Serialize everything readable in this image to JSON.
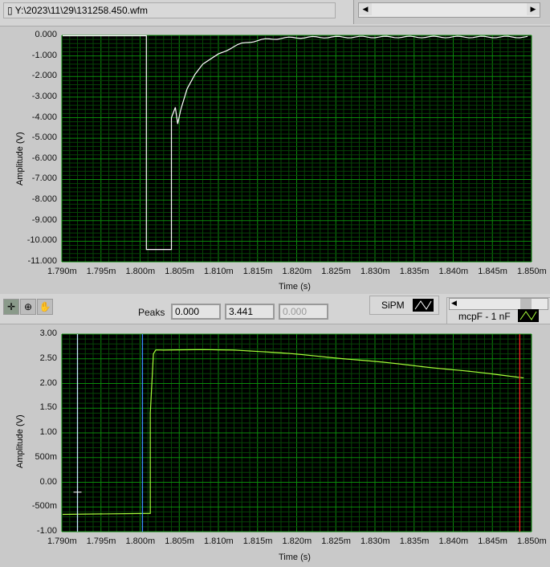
{
  "file_path": "Y:\\2023\\11\\29\\131258.450.wfm",
  "top_graph": {
    "ylabel": "Amplitude (V)",
    "xlabel": "Time (s)",
    "yticks": [
      "0.000",
      "-1.000",
      "-2.000",
      "-3.000",
      "-4.000",
      "-5.000",
      "-6.000",
      "-7.000",
      "-8.000",
      "-9.000",
      "-10.000",
      "-11.000"
    ],
    "xticks": [
      "1.790m",
      "1.795m",
      "1.800m",
      "1.805m",
      "1.810m",
      "1.815m",
      "1.820m",
      "1.825m",
      "1.830m",
      "1.835m",
      "1.840m",
      "1.845m",
      "1.850m"
    ],
    "trace_color": "#ffffff"
  },
  "bottom_graph": {
    "ylabel": "Amplitude (V)",
    "xlabel": "Time (s)",
    "yticks": [
      "3.00",
      "2.50",
      "2.00",
      "1.50",
      "1.00",
      "500m",
      "0.00",
      "-500m",
      "-1.00"
    ],
    "xticks": [
      "1.790m",
      "1.795m",
      "1.800m",
      "1.805m",
      "1.810m",
      "1.815m",
      "1.820m",
      "1.825m",
      "1.830m",
      "1.835m",
      "1.840m",
      "1.845m",
      "1.850m"
    ],
    "trace_color": "#a8ff3a",
    "cursors": [
      {
        "x_ms": 1.792,
        "color": "#c8e8ff"
      },
      {
        "x_ms": 1.8003,
        "color": "#3a8cff"
      },
      {
        "x_ms": 1.8485,
        "color": "#ff2020"
      }
    ]
  },
  "peaks": {
    "label": "Peaks",
    "values": [
      "0.000",
      "3.441",
      "0.000"
    ]
  },
  "legend": {
    "sipm": "SiPM",
    "mcp": "mcpF - 1 nF"
  },
  "colors": {
    "plot_bg": "#000000",
    "major_grid": "#0b8a0b",
    "minor_grid": "#064406"
  }
}
